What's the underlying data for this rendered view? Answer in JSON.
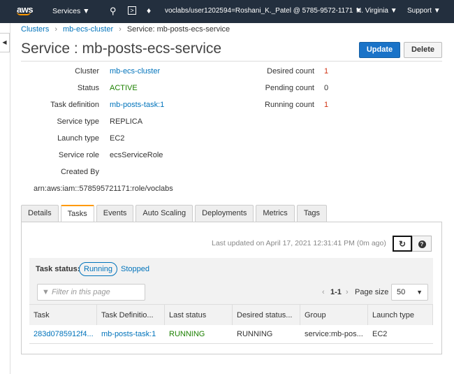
{
  "topbar": {
    "logo": "aws",
    "services": "Services ▼",
    "account": "voclabs/user1202594=Roshani_K._Patel @ 5785-9572-1171 ▼",
    "region": "N. Virginia ▼",
    "support": "Support ▼"
  },
  "breadcrumb": [
    "Clusters",
    "mb-ecs-cluster",
    "Service: mb-posts-ecs-service"
  ],
  "title": "Service : mb-posts-ecs-service",
  "buttons": {
    "update": "Update",
    "delete": "Delete"
  },
  "details_left": [
    {
      "label": "Cluster",
      "value": "mb-ecs-cluster",
      "type": "link"
    },
    {
      "label": "Status",
      "value": "ACTIVE",
      "type": "green"
    },
    {
      "label": "Task definition",
      "value": "mb-posts-task:1",
      "type": "link"
    },
    {
      "label": "Service type",
      "value": "REPLICA",
      "type": "text"
    },
    {
      "label": "Launch type",
      "value": "EC2",
      "type": "text"
    },
    {
      "label": "Service role",
      "value": "ecsServiceRole",
      "type": "text"
    },
    {
      "label": "Created By",
      "value": "",
      "type": "text"
    }
  ],
  "created_by_arn": "arn:aws:iam::578595721171:role/voclabs",
  "details_right": [
    {
      "label": "Desired count",
      "value": "1",
      "type": "red"
    },
    {
      "label": "Pending count",
      "value": "0",
      "type": "text"
    },
    {
      "label": "Running count",
      "value": "1",
      "type": "red"
    }
  ],
  "tabs": [
    {
      "label": "Details"
    },
    {
      "label": "Tasks",
      "active": true
    },
    {
      "label": "Events"
    },
    {
      "label": "Auto Scaling"
    },
    {
      "label": "Deployments"
    },
    {
      "label": "Metrics"
    },
    {
      "label": "Tags"
    }
  ],
  "tasks": {
    "last_updated": "Last updated on April 17, 2021 12:31:41 PM (0m ago)",
    "status_label": "Task status:",
    "running": "Running",
    "stopped": "Stopped",
    "filter_placeholder": "Filter in this page",
    "pagination": "1-1",
    "page_size_label": "Page size",
    "page_size": "50",
    "columns": [
      "Task",
      "Task Definitio...",
      "Last status",
      "Desired status...",
      "Group",
      "Launch type"
    ],
    "rows": [
      [
        "283d0785912f4...",
        "mb-posts-task:1",
        "RUNNING",
        "RUNNING",
        "service:mb-pos...",
        "EC2"
      ]
    ]
  }
}
